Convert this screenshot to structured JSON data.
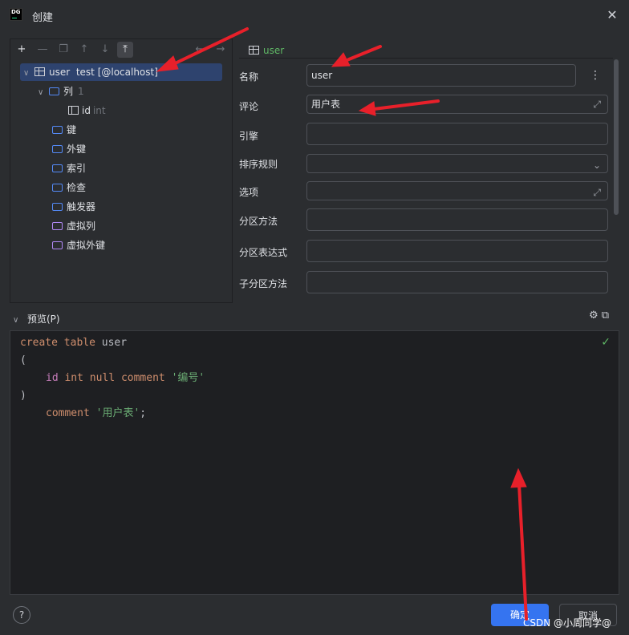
{
  "window": {
    "title": "创建",
    "logo_text": "DG"
  },
  "tree": {
    "root_name": "user",
    "root_schema": "test [@localhost]",
    "columns_folder": "列",
    "columns_count": "1",
    "column": {
      "name": "id",
      "type": "int"
    },
    "folders": [
      "键",
      "外键",
      "索引",
      "检查",
      "触发器"
    ],
    "virtual_folders": [
      "虚拟列",
      "虚拟外键"
    ]
  },
  "tab": {
    "label": "user"
  },
  "form": {
    "name_label": "名称",
    "name_value": "user",
    "comment_label": "评论",
    "comment_value": "用户表",
    "engine_label": "引擎",
    "collation_label": "排序规则",
    "options_label": "选项",
    "partition_label": "分区方法",
    "partition_expr_label": "分区表达式",
    "subpartition_label": "子分区方法"
  },
  "preview": {
    "label": "预览(P)",
    "code": {
      "kw_create": "create",
      "kw_table": "table",
      "table_name": "user",
      "open_paren": "(",
      "col_name": "id",
      "col_type": "int",
      "kw_null": "null",
      "kw_comment": "comment",
      "col_comment": "'编号'",
      "close_paren": ")",
      "kw_comment2": "comment",
      "table_comment": "'用户表'",
      "semicolon": ";"
    }
  },
  "footer": {
    "help": "?",
    "ok_label": "确定",
    "cancel_label": "取消",
    "watermark": "CSDN @小周同学@"
  },
  "colors": {
    "accent": "#3574f0",
    "arrow": "#e8202a",
    "selection": "#2e436e"
  }
}
